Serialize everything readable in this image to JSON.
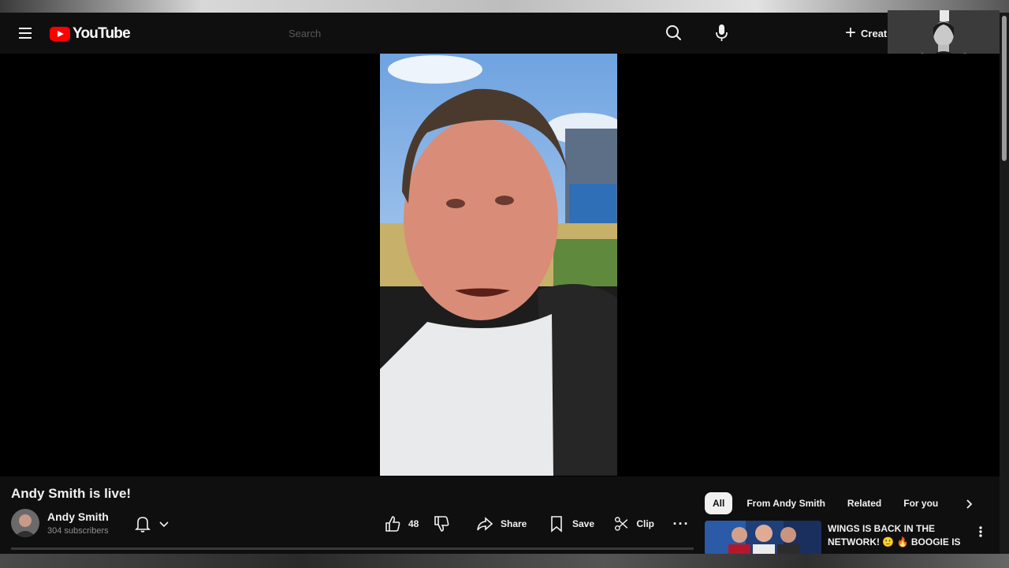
{
  "header": {
    "logo_text": "YouTube",
    "search_placeholder": "Search",
    "create_label": "Creat"
  },
  "video": {
    "title": "Andy Smith is live!"
  },
  "channel": {
    "name": "Andy Smith",
    "subscribers": "304 subscribers"
  },
  "actions": {
    "like_count": "48",
    "share_label": "Share",
    "save_label": "Save",
    "clip_label": "Clip",
    "more_label": "···"
  },
  "sidebar": {
    "chips": [
      {
        "label": "All",
        "active": true
      },
      {
        "label": "From Andy Smith",
        "active": false
      },
      {
        "label": "Related",
        "active": false
      },
      {
        "label": "For you",
        "active": false
      }
    ],
    "recommendations": [
      {
        "title": "WINGS IS BACK IN THE NETWORK! 🙂 🔥 BOOGIE IS ..."
      }
    ]
  },
  "icons": {
    "menu": "hamburger-menu-icon",
    "search": "search-icon",
    "mic": "microphone-icon",
    "create": "plus-icon",
    "bell": "bell-icon",
    "like": "thumbs-up-icon",
    "dislike": "thumbs-down-icon",
    "share": "share-arrow-icon",
    "save": "bookmark-icon",
    "clip": "scissors-icon",
    "more": "more-horizontal-icon",
    "next": "chevron-right-icon"
  },
  "colors": {
    "background": "#0f0f0f",
    "brand_red": "#ff0000",
    "text_primary": "#f1f1f1",
    "text_secondary": "#909090"
  }
}
